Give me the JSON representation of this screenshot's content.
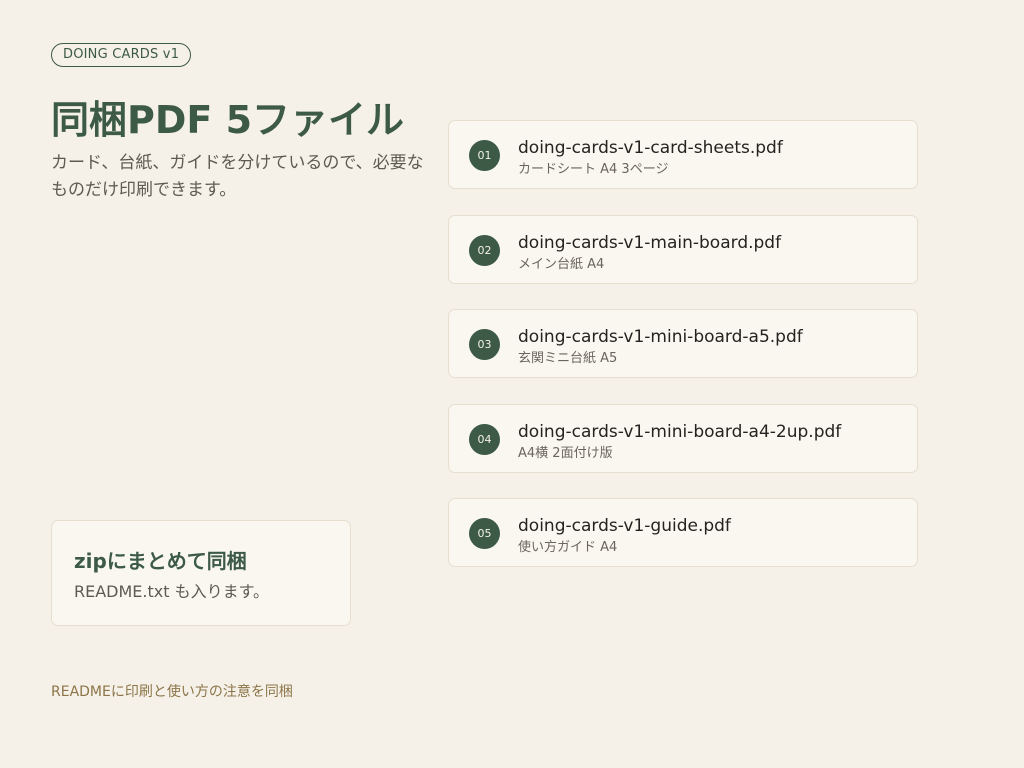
{
  "badge": "DOING CARDS v1",
  "title": "同梱PDF 5ファイル",
  "subtitle": "カード、台紙、ガイドを分けているので、必要なものだけ印刷できます。",
  "files": [
    {
      "num": "01",
      "name": "doing-cards-v1-card-sheets.pdf",
      "desc": "カードシート A4 3ページ"
    },
    {
      "num": "02",
      "name": "doing-cards-v1-main-board.pdf",
      "desc": "メイン台紙 A4"
    },
    {
      "num": "03",
      "name": "doing-cards-v1-mini-board-a5.pdf",
      "desc": "玄関ミニ台紙 A5"
    },
    {
      "num": "04",
      "name": "doing-cards-v1-mini-board-a4-2up.pdf",
      "desc": "A4横 2面付け版"
    },
    {
      "num": "05",
      "name": "doing-cards-v1-guide.pdf",
      "desc": "使い方ガイド A4"
    }
  ],
  "zip": {
    "title": "zipにまとめて同梱",
    "desc": "README.txt も入ります。"
  },
  "footer_note": "READMEに印刷と使い方の注意を同梱",
  "colors": {
    "background": "#f5f1e8",
    "accent": "#3c5a45",
    "footer_text": "#8c7548"
  }
}
